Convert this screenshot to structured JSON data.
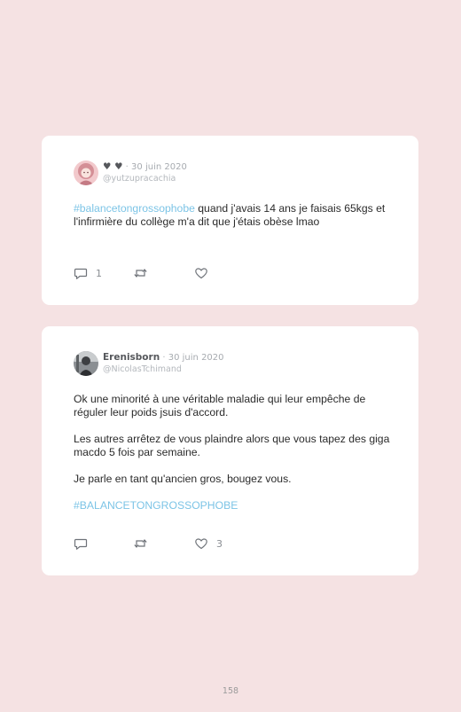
{
  "tweets": [
    {
      "name": "♥ ♥",
      "separator": "·",
      "date": "30 juin 2020",
      "handle": "@yutzupracachia",
      "hashtag": "#balancetongrossophobe",
      "text_after_hashtag": " quand j'avais 14 ans je faisais 65kgs et l'infirmière du collège m'a dit que j'étais obèse lmao",
      "replies": "1",
      "retweets": "",
      "likes": ""
    },
    {
      "name": "Erenisborn",
      "separator": "·",
      "date": "30 juin 2020",
      "handle": "@NicolasTchimand",
      "paragraphs": [
        "Ok une minorité à une véritable maladie qui leur empêche de réguler leur poids jsuis d'accord.",
        "Les autres arrêtez de vous plaindre alors que vous tapez des giga macdo 5 fois par semaine.",
        "Je parle en tant qu'ancien gros, bougez vous."
      ],
      "hashtag": "#BALANCETONGROSSOPHOBE",
      "replies": "",
      "retweets": "",
      "likes": "3"
    }
  ],
  "icons": {
    "reply": "comment-bubble-icon",
    "retweet": "retweet-icon",
    "like": "heart-icon"
  },
  "colors": {
    "background": "#f5e2e3",
    "card": "#ffffff",
    "hashtag": "#7cc4e6"
  },
  "page_number": "158"
}
